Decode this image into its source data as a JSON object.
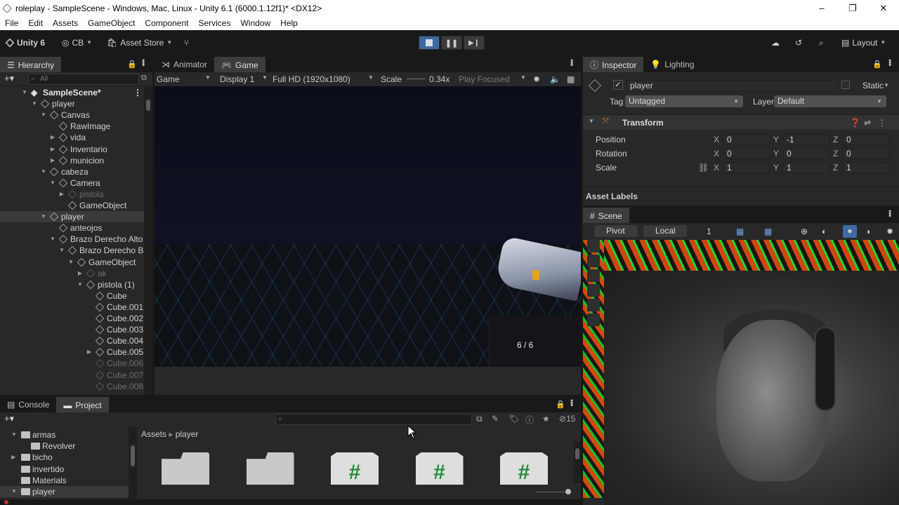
{
  "window": {
    "title": "roleplay - SampleScene - Windows, Mac, Linux - Unity 6.1 (6000.1.12f1)* <DX12>",
    "controls": [
      "–",
      "❐",
      "✕"
    ]
  },
  "menu": [
    "File",
    "Edit",
    "Assets",
    "GameObject",
    "Component",
    "Services",
    "Window",
    "Help"
  ],
  "toolbar": {
    "unity_label": "Unity 6",
    "account_label": "CB",
    "asset_store_label": "Asset Store",
    "layout_label": "Layout",
    "play_state": "playing"
  },
  "hierarchy": {
    "tab": "Hierarchy",
    "search_placeholder": "All",
    "scene_name": "SampleScene*",
    "items": [
      {
        "label": "player",
        "depth": 1,
        "expanded": true
      },
      {
        "label": "Canvas",
        "depth": 2,
        "expanded": true
      },
      {
        "label": "RawImage",
        "depth": 3,
        "expanded": null
      },
      {
        "label": "vida",
        "depth": 3,
        "expanded": false
      },
      {
        "label": "Inventario",
        "depth": 3,
        "expanded": false
      },
      {
        "label": "municion",
        "depth": 3,
        "expanded": false
      },
      {
        "label": "cabeza",
        "depth": 2,
        "expanded": true
      },
      {
        "label": "Camera",
        "depth": 3,
        "expanded": true
      },
      {
        "label": "pistola",
        "depth": 4,
        "expanded": false,
        "dim": true
      },
      {
        "label": "GameObject",
        "depth": 4,
        "expanded": null
      },
      {
        "label": "player",
        "depth": 2,
        "expanded": true,
        "selected": true
      },
      {
        "label": "anteojos",
        "depth": 3,
        "expanded": null
      },
      {
        "label": "Brazo Derecho Alto",
        "depth": 3,
        "expanded": true
      },
      {
        "label": "Brazo Derecho Ba",
        "depth": 4,
        "expanded": true
      },
      {
        "label": "GameObject",
        "depth": 5,
        "expanded": true
      },
      {
        "label": "ak",
        "depth": 6,
        "expanded": false,
        "dim": true
      },
      {
        "label": "pistola (1)",
        "depth": 6,
        "expanded": true
      },
      {
        "label": "Cube",
        "depth": 7,
        "expanded": null
      },
      {
        "label": "Cube.001",
        "depth": 7,
        "expanded": null
      },
      {
        "label": "Cube.002",
        "depth": 7,
        "expanded": null
      },
      {
        "label": "Cube.003",
        "depth": 7,
        "expanded": null
      },
      {
        "label": "Cube.004",
        "depth": 7,
        "expanded": null
      },
      {
        "label": "Cube.005",
        "depth": 7,
        "expanded": false
      },
      {
        "label": "Cube.006",
        "depth": 7,
        "expanded": null,
        "dim": true
      },
      {
        "label": "Cube.007",
        "depth": 7,
        "expanded": null,
        "dim": true
      },
      {
        "label": "Cube.008",
        "depth": 7,
        "expanded": null,
        "dim": true
      }
    ]
  },
  "game": {
    "tabs": [
      "Animator",
      "Game"
    ],
    "view_mode": "Game",
    "display": "Display 1",
    "resolution": "Full HD (1920x1080)",
    "scale_label": "Scale",
    "scale_value": "0.34x",
    "play_mode": "Play Focused",
    "ammo": "6 / 6"
  },
  "inspector": {
    "tabs": [
      "Inspector",
      "Lighting"
    ],
    "object_name": "player",
    "static_label": "Static",
    "tag_label": "Tag",
    "tag_value": "Untagged",
    "layer_label": "Layer",
    "layer_value": "Default",
    "component": "Transform",
    "rows": [
      {
        "label": "Position",
        "x": "0",
        "y": "-1",
        "z": "0"
      },
      {
        "label": "Rotation",
        "x": "0",
        "y": "0",
        "z": "0"
      },
      {
        "label": "Scale",
        "x": "1",
        "y": "1",
        "z": "1"
      }
    ],
    "asset_labels": "Asset Labels"
  },
  "scene": {
    "tab": "Scene",
    "pivot": "Pivot",
    "space": "Local",
    "grid_value": "1"
  },
  "bottom": {
    "tabs": [
      "Console",
      "Project"
    ],
    "count": "15",
    "breadcrumb": [
      "Assets",
      "player"
    ],
    "tree": [
      {
        "label": "armas",
        "depth": 1,
        "expanded": true
      },
      {
        "label": "Revolver",
        "depth": 2,
        "expanded": null
      },
      {
        "label": "bicho",
        "depth": 1,
        "expanded": false
      },
      {
        "label": "invertido",
        "depth": 1,
        "expanded": null
      },
      {
        "label": "Materials",
        "depth": 1,
        "expanded": null
      },
      {
        "label": "player",
        "depth": 1,
        "expanded": true,
        "selected": true
      }
    ],
    "assets": [
      {
        "kind": "folder",
        "glyph": ""
      },
      {
        "kind": "folder",
        "glyph": ""
      },
      {
        "kind": "script",
        "glyph": "#"
      },
      {
        "kind": "script",
        "glyph": "#"
      },
      {
        "kind": "script",
        "glyph": "#"
      }
    ]
  }
}
